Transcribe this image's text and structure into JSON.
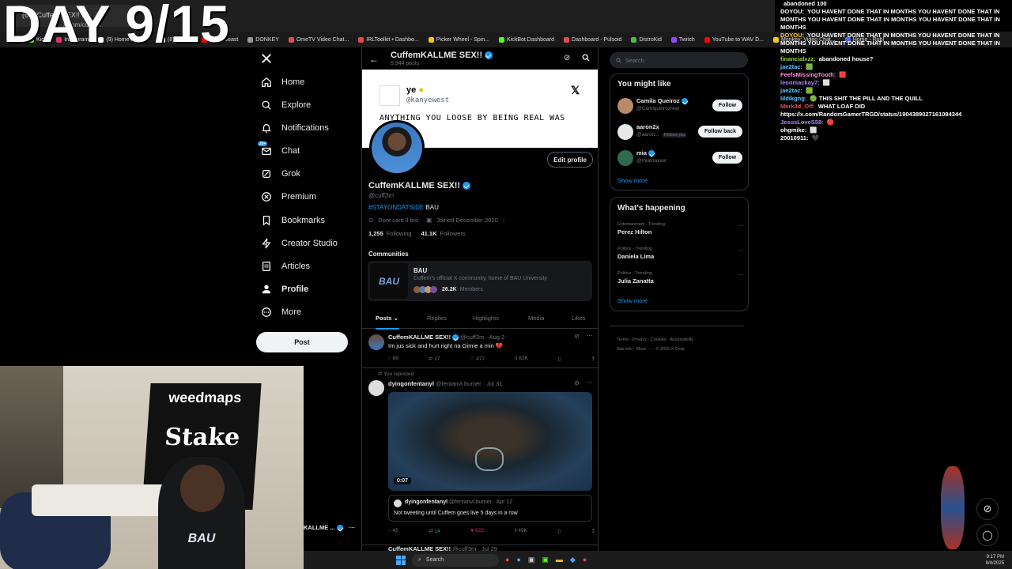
{
  "overlay": {
    "day_label": "DAY 9/15"
  },
  "browser": {
    "tabs": [
      "(60) Cuffem SEX!! ..."
    ],
    "url": "x.com/cuff3m",
    "bookmarks": [
      {
        "label": "Kick",
        "color": "#53fc18"
      },
      {
        "label": "Instagram",
        "color": "#e1306c"
      },
      {
        "label": "(9) Home / Twitter",
        "color": "#ffffff"
      },
      {
        "label": "(8) | Cuffe",
        "color": "#ffffff"
      },
      {
        "label": "(9) MrBeast",
        "color": "#ff0000"
      },
      {
        "label": "DONKEY",
        "color": "#999999"
      },
      {
        "label": "OmeTV Video Chat...",
        "color": "#e34c4c"
      },
      {
        "label": "IRLToolkit • Dashbo...",
        "color": "#e34c4c"
      },
      {
        "label": "Picker Wheel - Spin...",
        "color": "#f5c518"
      },
      {
        "label": "KickBot Dashboard",
        "color": "#53fc18"
      },
      {
        "label": "Dashboard - Pulsoid",
        "color": "#e34c4c"
      },
      {
        "label": "DistroKid",
        "color": "#4fb84f"
      },
      {
        "label": "Twitch",
        "color": "#9146ff"
      },
      {
        "label": "YouTube to WAV D...",
        "color": "#ff0000"
      },
      {
        "label": "Monkey: Video Chat...",
        "color": "#f5c518"
      },
      {
        "label": "Home - Robl",
        "color": "#5865f2"
      }
    ]
  },
  "nav": {
    "items": [
      {
        "label": "Home",
        "icon": "home-icon"
      },
      {
        "label": "Explore",
        "icon": "search-icon"
      },
      {
        "label": "Notifications",
        "icon": "bell-icon"
      },
      {
        "label": "Chat",
        "icon": "mail-icon",
        "badge": "20+"
      },
      {
        "label": "Grok",
        "icon": "grok-icon"
      },
      {
        "label": "Premium",
        "icon": "x-logo-icon"
      },
      {
        "label": "Bookmarks",
        "icon": "bookmark-icon"
      },
      {
        "label": "Creator Studio",
        "icon": "lightning-icon"
      },
      {
        "label": "Articles",
        "icon": "document-icon"
      },
      {
        "label": "Profile",
        "icon": "person-icon"
      },
      {
        "label": "More",
        "icon": "more-circle-icon"
      }
    ],
    "post_button": "Post",
    "account_name": "KALLME ..."
  },
  "profile": {
    "header_name": "CuffemKALLME SEX!!",
    "post_count": "5,944 posts",
    "banner": {
      "name": "ye",
      "handle": "@kanyewest",
      "text": "ANYTHING YOU LOOSE BY BEING REAL WAS"
    },
    "edit_button": "Edit profile",
    "name": "CuffemKALLME SEX!!",
    "handle": "@cuff3m",
    "bio_tag": "#STAYONDATSIDE",
    "bio_rest": " BAU",
    "location": "Dont care ll bro",
    "joined": "Joined December 2020",
    "following_count": "1,255",
    "following_label": "Following",
    "followers_count": "41.1K",
    "followers_label": "Followers"
  },
  "communities": {
    "title": "Communities",
    "name": "BAU",
    "description": "Cuffem's official X community, home of BAU University",
    "members_count": "26.2K",
    "members_label": "Members"
  },
  "tabs": [
    "Posts",
    "Replies",
    "Highlights",
    "Media",
    "Likes"
  ],
  "posts": [
    {
      "name": "CuffemKALLME SEX!!",
      "handle": "@cuff3m",
      "date": "· Aug 2",
      "text": "Im jus sick and hurt right na Gimie a min 💔",
      "replies": "68",
      "reposts": "27",
      "likes": "477",
      "views": "62K"
    },
    {
      "repost_label": "You reposted",
      "name": "dyingonfentanyl",
      "handle": "@fentanvl.burner",
      "date": "· Jul 31",
      "video_time": "0:07",
      "quote_name": "dyingonfentanyl",
      "quote_handle": "@fentanvl.burner",
      "quote_date": "· Apr 12",
      "quote_text": "Not tweeting until Cuffem goes live 5 days in a row",
      "replies": "45",
      "reposts": "14",
      "likes": "823",
      "views": "49K"
    },
    {
      "name": "CuffemKALLME SEX!!",
      "handle": "@cuff3m",
      "date": "· Jul 29"
    }
  ],
  "right": {
    "search_placeholder": "Search",
    "might_like_title": "You might like",
    "suggestions": [
      {
        "name": "Camila Queiroz",
        "handle": "@Camiqueirozreal",
        "button": "Follow",
        "follows_you": ""
      },
      {
        "name": "aaron2x",
        "handle": "@aaron...",
        "button": "Follow back",
        "follows_you": "Follows you"
      },
      {
        "name": "mia",
        "handle": "@miamaxxer",
        "button": "Follow",
        "follows_you": ""
      }
    ],
    "show_more": "Show more",
    "happening_title": "What's happening",
    "trends": [
      {
        "category": "Entertainment · Trending",
        "name": "Perez Hilton"
      },
      {
        "category": "Politics · Trending",
        "name": "Daniela Lima"
      },
      {
        "category": "Politics · Trending",
        "name": "Julia Zanatta"
      }
    ],
    "footer_line1": "Terms  ·  Privacy  ·  Cookies  ·  Accessibility",
    "footer_line2": "Ads info  ·  More ···  ·  © 2025 X Corp."
  },
  "chat": [
    {
      "user": "",
      "color": "#ffffff",
      "text": "abandoned 100"
    },
    {
      "user": "DOYOU:",
      "color": "#ffffff",
      "text": "YOU HAVENT DONE THAT IN MONTHS YOU HAVENT DONE THAT IN MONTHS YOU HAVENT DONE THAT IN MONTHS YOU HAVENT DONE THAT IN MONTHS"
    },
    {
      "user": "DOYOU:",
      "color": "#f5c518",
      "text": "YOU HAVENT DONE THAT IN MONTHS YOU HAVENT DONE THAT IN MONTHS YOU HAVENT DONE THAT IN MONTHS YOU HAVENT DONE THAT IN MONTHS"
    },
    {
      "user": "financialxzz:",
      "color": "#9acd32",
      "text": "abandoned house?"
    },
    {
      "user": "jae2tac:",
      "color": "#5cc8ff",
      "text": "🟩"
    },
    {
      "user": "FeefsMissingTooth:",
      "color": "#ff8cd9",
      "text": "🟥"
    },
    {
      "user": "leonmackay7:",
      "color": "#b084ff",
      "text": "⬜"
    },
    {
      "user": "jae2tac:",
      "color": "#5cc8ff",
      "text": "🟩"
    },
    {
      "user": "lildikgng:",
      "color": "#5cc8ff",
      "text": "🟢 THIS SHIT THE PILL AND THE QUILL"
    },
    {
      "user": "Merk3d_Off:",
      "color": "#e34c4c",
      "text": "WHAT LOAF DID https://x.com/RandomGamerTRGD/status/1904389027161084344"
    },
    {
      "user": "JesusLoveS58:",
      "color": "#b084ff",
      "text": "🔴"
    },
    {
      "user": "ohgmike:",
      "color": "#ffffff",
      "text": "⬜"
    },
    {
      "user": "20010911:",
      "color": "#ffffff",
      "text": "🖤"
    }
  ],
  "taskbar": {
    "search_placeholder": "Search",
    "time": "9:17 PM",
    "date": "8/4/2025"
  }
}
